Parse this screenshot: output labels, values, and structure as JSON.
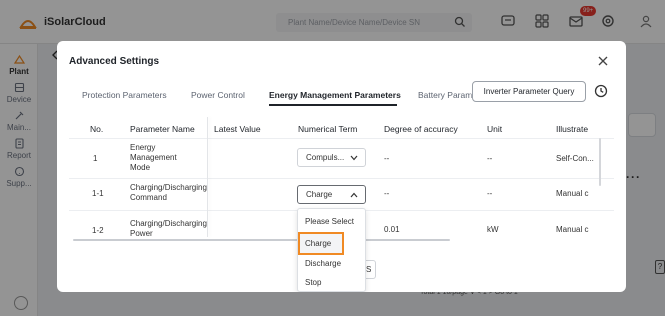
{
  "app": {
    "brand": "iSolarCloud",
    "search_placeholder": "Plant Name/Device Name/Device SN",
    "notification_count": "99+",
    "colors": {
      "accent": "#f08a24",
      "badge": "#e8382f"
    }
  },
  "sidebar": {
    "items": [
      {
        "label": "Plant",
        "icon": "plant-icon"
      },
      {
        "label": "Device",
        "icon": "device-icon"
      },
      {
        "label": "Main...",
        "icon": "maintenance-icon"
      },
      {
        "label": "Report",
        "icon": "report-icon"
      },
      {
        "label": "Supp...",
        "icon": "support-icon"
      }
    ]
  },
  "background": {
    "pager_text": "Total 1    10/page  ∨    <    1    >    Go to    1",
    "help_label": "?"
  },
  "modal": {
    "title": "Advanced Settings",
    "tabs": [
      {
        "label": "Protection Parameters"
      },
      {
        "label": "Power Control"
      },
      {
        "label": "Energy Management Parameters"
      },
      {
        "label": "Battery Param"
      }
    ],
    "active_tab": "Energy Management Parameters",
    "query_button": "Inverter Parameter Query",
    "columns": [
      "No.",
      "Parameter Name",
      "Latest Value",
      "Numerical Term",
      "Degree of accuracy",
      "Unit",
      "Illustrate"
    ],
    "rows": [
      {
        "no": "1",
        "name": "Energy Management Mode",
        "latest": "",
        "term": "Compuls...",
        "accuracy": "--",
        "unit": "--",
        "illustrate": "Self-Con..."
      },
      {
        "no": "1-1",
        "name": "Charging/Discharging Command",
        "latest": "",
        "term": "Charge",
        "accuracy": "--",
        "unit": "--",
        "illustrate": "Manual c"
      },
      {
        "no": "1-2",
        "name": "Charging/Discharging Power",
        "latest": "",
        "term": "",
        "accuracy": "0.01",
        "unit": "kW",
        "illustrate": "Manual c"
      }
    ],
    "dropdown": {
      "options": [
        "Please Select",
        "Charge",
        "Discharge",
        "Stop"
      ],
      "selected": "Charge"
    },
    "footer_peek": "S"
  }
}
